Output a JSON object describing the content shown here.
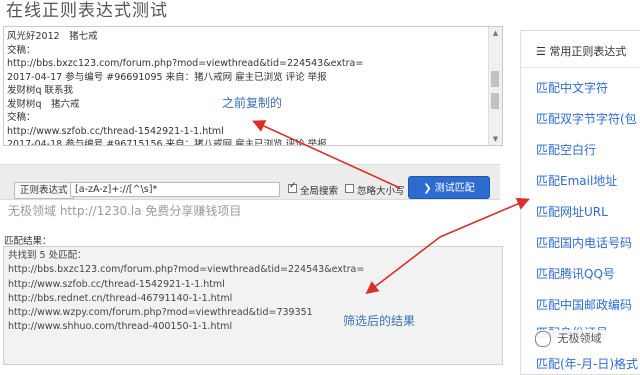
{
  "page": {
    "title": "在线正则表达式测试"
  },
  "source": {
    "lines": [
      "风光好2012　猪七戒",
      "交稿：",
      "http://bbs.bxzc123.com/forum.php?mod=viewthread&tid=224543&extra=",
      "2017-04-17 参与编号 #96691095 来自：猪八戒网 雇主已浏览 评论 举报",
      "发财树q 联系我",
      "发财树q　猪六戒",
      "交稿：",
      "http://www.szfob.cc/thread-1542921-1-1.html",
      "2017-04-18 参与编号 #96715156 来自：猪八戒网 雇主已浏览 评论 举报"
    ],
    "annotation": "之前复制的"
  },
  "toolbar": {
    "regex_label": "正则表达式",
    "regex_value": "[a-zA-z]+://[^\\s]*",
    "global_label": "全局搜索",
    "ignore_case_label": "忽略大小写",
    "global_checked": true,
    "ignore_case_checked": false,
    "test_button": "测试匹配"
  },
  "watermark": "无极领域 http://1230.la  免费分享赚钱项目",
  "result": {
    "title": "匹配结果：",
    "lines": [
      "共找到 5 处匹配：",
      "http://bbs.bxzc123.com/forum.php?mod=viewthread&tid=224543&extra=",
      "http://www.szfob.cc/thread-1542921-1-1.html",
      "http://bbs.rednet.cn/thread-46791140-1-1.html",
      "http://www.wzpy.com/forum.php?mod=viewthread&tid=739351",
      "http://www.shhuo.com/thread-400150-1-1.html"
    ],
    "annotation": "筛选后的结果"
  },
  "sidebar": {
    "header": "常用正则表达式",
    "items": [
      "匹配中文字符",
      "匹配双字节字符(包",
      "匹配空白行",
      "匹配Email地址",
      "匹配网址URL",
      "匹配国内电话号码",
      "匹配腾讯QQ号",
      "匹配中国邮政编码",
      "匹配身份证号",
      "匹配(年-月-日)格式"
    ]
  },
  "badge": "无极领域",
  "colors": {
    "accent": "#2d6bd1",
    "arrow": "#d9302a",
    "annotation": "#3b6fb6"
  }
}
